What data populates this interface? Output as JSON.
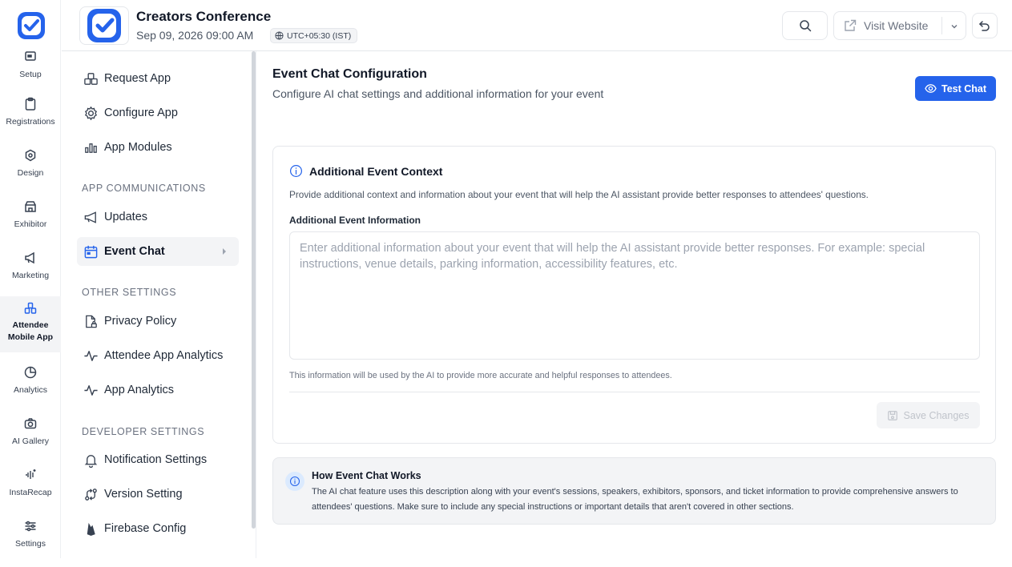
{
  "rail": {
    "logo_icon": "brand-logo-icon",
    "items": [
      {
        "label": "Setup",
        "icon": "setup-icon"
      },
      {
        "label": "Registrations",
        "icon": "clipboard-icon"
      },
      {
        "label": "Design",
        "icon": "design-icon"
      },
      {
        "label": "Exhibitor",
        "icon": "booth-icon"
      },
      {
        "label": "Marketing",
        "icon": "megaphone-icon"
      },
      {
        "label": "Attendee Mobile App",
        "icon": "mobile-app-icon",
        "active": true
      },
      {
        "label": "Analytics",
        "icon": "pie-chart-icon"
      },
      {
        "label": "AI Gallery",
        "icon": "camera-icon"
      },
      {
        "label": "InstaRecap",
        "icon": "sparkle-icon"
      },
      {
        "label": "Settings",
        "icon": "sliders-icon"
      }
    ]
  },
  "header": {
    "event_title": "Creators Conference",
    "event_date": "Sep 09, 2026 09:00 AM",
    "timezone": "UTC+05:30 (IST)",
    "visit_label": "Visit Website"
  },
  "subnav": {
    "items_top": [
      {
        "label": "Request App",
        "icon": "boxes-icon"
      },
      {
        "label": "Configure App",
        "icon": "gear-icon"
      },
      {
        "label": "App Modules",
        "icon": "bar-chart-icon"
      }
    ],
    "section_comm": "APP COMMUNICATIONS",
    "items_comm": [
      {
        "label": "Updates",
        "icon": "megaphone-icon"
      },
      {
        "label": "Event Chat",
        "icon": "calendar-icon",
        "active": true
      }
    ],
    "section_other": "OTHER SETTINGS",
    "items_other": [
      {
        "label": "Privacy Policy",
        "icon": "file-lock-icon"
      },
      {
        "label": "Attendee App Analytics",
        "icon": "activity-icon"
      },
      {
        "label": "App Analytics",
        "icon": "activity-icon"
      }
    ],
    "section_dev": "DEVELOPER SETTINGS",
    "items_dev": [
      {
        "label": "Notification Settings",
        "icon": "bell-icon"
      },
      {
        "label": "Version Setting",
        "icon": "git-compare-icon"
      },
      {
        "label": "Firebase Config",
        "icon": "firebase-icon"
      }
    ]
  },
  "main": {
    "title": "Event Chat Configuration",
    "subtitle": "Configure AI chat settings and additional information for your event",
    "test_chat_label": "Test Chat",
    "card": {
      "title": "Additional Event Context",
      "description": "Provide additional context and information about your event that will help the AI assistant provide better responses to attendees' questions.",
      "field_label": "Additional Event Information",
      "field_value": "",
      "field_placeholder": "Enter additional information about your event that will help the AI assistant provide better responses. For example: special instructions, venue details, parking information, accessibility features, etc.",
      "helper_text": "This information will be used by the AI to provide more accurate and helpful responses to attendees.",
      "save_label": "Save Changes"
    },
    "info": {
      "title": "How Event Chat Works",
      "text": "The AI chat feature uses this description along with your event's sessions, speakers, exhibitors, sponsors, and ticket information to provide comprehensive answers to attendees' questions. Make sure to include any special instructions or important details that aren't covered in other sections."
    }
  },
  "colors": {
    "accent": "#2563eb",
    "brand": "#2563eb",
    "active_bg": "#f3f4f6"
  }
}
